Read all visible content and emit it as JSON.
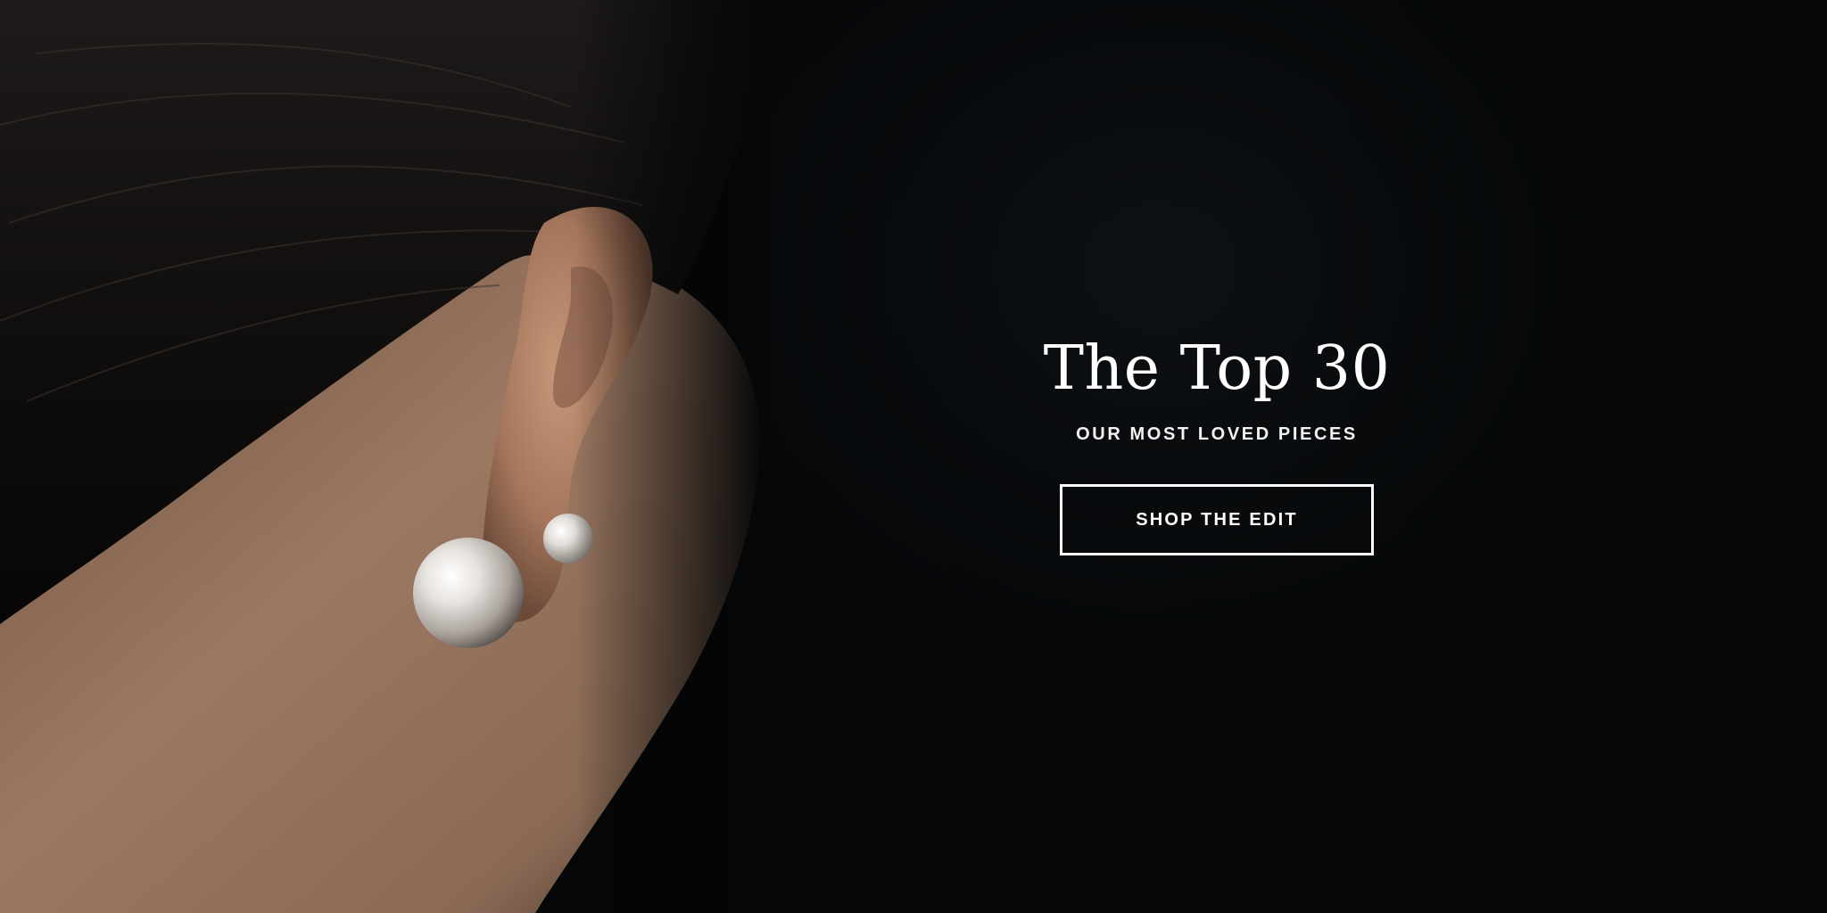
{
  "hero": {
    "title": "The Top 30",
    "subtitle": "OUR MOST LOVED PIECES",
    "cta_label": "SHOP THE EDIT",
    "image_alt": "Close-up of ear wearing double pearl earring"
  },
  "colors": {
    "background": "#050708",
    "text": "#ffffff",
    "button_border": "#ffffff"
  }
}
